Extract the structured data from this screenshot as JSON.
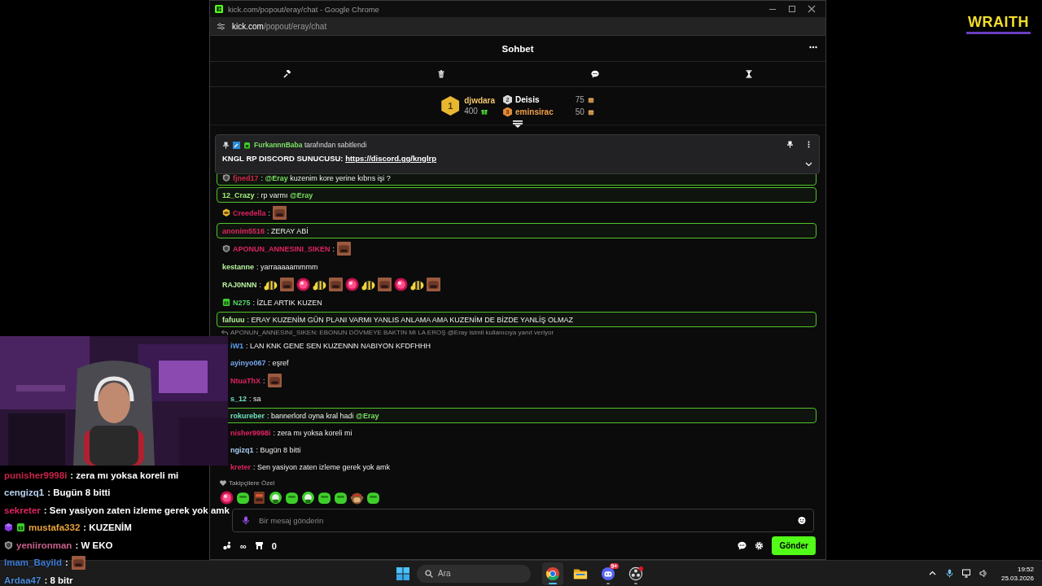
{
  "browser": {
    "title": "kick.com/popout/eray/chat - Google Chrome",
    "url_host": "kick.com",
    "url_path": "/popout/eray/chat"
  },
  "chat": {
    "title": "Sohbet",
    "leaderboard": [
      {
        "rank": "1",
        "user": "djwdara",
        "amount": "400",
        "reward": {
          "kind": "gift"
        },
        "color": "#f2c46a"
      },
      {
        "rank": "2",
        "user": "Deisis",
        "amount": "75",
        "reward": {
          "kind": "coin"
        },
        "color": "#ffffff"
      },
      {
        "rank": "3",
        "user": "eminsirac",
        "amount": "50",
        "reward": {
          "kind": "coin"
        },
        "color": "#f0a04a"
      }
    ],
    "pinned": {
      "pinned_by": "FurkannnBaba",
      "suffix": "tarafından sabitlendi",
      "text": "KNGL RP DISCORD SUNUCUSU:",
      "link": "https://discord.gg/knglrp"
    },
    "messages": [
      {
        "badge": {
          "kind": "shield"
        },
        "user": "fjned17",
        "color": "#d4264d",
        "highlighted": true,
        "text": [
          {
            "kind": "text",
            "text": ": "
          },
          {
            "kind": "mention",
            "text": "@Eray"
          },
          {
            "kind": "text",
            "text": " kuzenim kore yerine kıbrıs işi ?"
          }
        ]
      },
      {
        "user": "12_Crazy",
        "color": "#a3f07a",
        "highlighted": true,
        "text": [
          {
            "kind": "text",
            "text": ": rp varmı "
          },
          {
            "kind": "mention",
            "text": "@Eray"
          }
        ]
      },
      {
        "badge": {
          "kind": "crown"
        },
        "user": "Creedella",
        "color": "#e0245e",
        "highlighted": false,
        "text": [
          {
            "kind": "text",
            "text": ":"
          }
        ],
        "emotes": [
          {
            "kind": "face"
          }
        ]
      },
      {
        "user": "anonim5516",
        "color": "#e0245e",
        "highlighted": true,
        "text": [
          {
            "kind": "text",
            "text": ": ZERAY ABİ"
          }
        ]
      },
      {
        "badge": {
          "kind": "shield"
        },
        "user": "APONUN_ANNESINI_SIKEN",
        "color": "#e0245e",
        "highlighted": false,
        "text": [
          {
            "kind": "text",
            "text": ":"
          }
        ],
        "emotes": [
          {
            "kind": "face"
          }
        ]
      },
      {
        "user": "kestanne",
        "color": "#b6f09c",
        "highlighted": false,
        "text": [
          {
            "kind": "text",
            "text": ": yarraaaaammmm"
          }
        ]
      },
      {
        "user": "RAJ0NNN",
        "color": "#b6f09c",
        "highlighted": false,
        "text": [
          {
            "kind": "text",
            "text": ":"
          }
        ],
        "emotes": [
          {
            "kind": "bee"
          },
          {
            "kind": "face"
          },
          {
            "kind": "orb"
          },
          {
            "kind": "bee"
          },
          {
            "kind": "face"
          },
          {
            "kind": "orb"
          },
          {
            "kind": "bee"
          },
          {
            "kind": "face"
          },
          {
            "kind": "orb"
          },
          {
            "kind": "bee"
          },
          {
            "kind": "face"
          }
        ]
      },
      {
        "badge": {
          "kind": "gift"
        },
        "user": "N275",
        "color": "#56d86a",
        "highlighted": false,
        "text": [
          {
            "kind": "text",
            "text": ": İZLE ARTIK KUZEN"
          }
        ]
      },
      {
        "user": "fafuuu",
        "color": "#b6f09c",
        "highlighted": true,
        "text": [
          {
            "kind": "text",
            "text": ": ERAY KUZENİM GÜN PLANI VARMI YANLIS ANLAMA AMA KUZENİM DE BİZDE YANLİŞ OLMAZ"
          }
        ]
      },
      {
        "reply": "APONUN_ANNESINI_SIKEN: EBONUN DÖVMEYE BAKTIN MI LA EROŞ @Eray isimli kullanıcıya yanıt veriyor",
        "partly_hidden": true,
        "user": "iW1",
        "color": "#5aa0f0",
        "highlighted": false,
        "text": [
          {
            "kind": "text",
            "text": ": LAN KNK GENE SEN KUZENNN NABIYON KFDFHHH"
          }
        ]
      },
      {
        "partly_hidden": true,
        "user": "ayinyo067",
        "color": "#78a8f0",
        "highlighted": false,
        "text": [
          {
            "kind": "text",
            "text": ": eşref"
          }
        ]
      },
      {
        "partly_hidden": true,
        "user": "NtuaThX",
        "color": "#e0245e",
        "highlighted": false,
        "text": [
          {
            "kind": "text",
            "text": ":"
          }
        ],
        "emotes": [
          {
            "kind": "face"
          }
        ]
      },
      {
        "partly_hidden": true,
        "user": "s_12",
        "color": "#6fe0c0",
        "highlighted": false,
        "text": [
          {
            "kind": "text",
            "text": ": sa"
          }
        ]
      },
      {
        "partly_hidden": true,
        "user": "rokureber",
        "color": "#6fe0c0",
        "highlighted": true,
        "text": [
          {
            "kind": "text",
            "text": ": bannerlord oyna kral hadi "
          },
          {
            "kind": "mention",
            "text": "@Eray"
          }
        ]
      },
      {
        "partly_hidden": true,
        "user": "nisher9998i",
        "color": "#e0245e",
        "highlighted": false,
        "text": [
          {
            "kind": "text",
            "text": ": zera mı yoksa koreli mi"
          }
        ]
      },
      {
        "partly_hidden": true,
        "user": "ngizq1",
        "color": "#a8c8f0",
        "highlighted": false,
        "text": [
          {
            "kind": "text",
            "text": ": Bugün 8 bitti"
          }
        ]
      },
      {
        "partly_hidden": true,
        "user": "kreter",
        "color": "#e0245e",
        "highlighted": false,
        "text": [
          {
            "kind": "text",
            "text": ": Sen yasiyon zaten izleme gerek yok amk"
          }
        ]
      }
    ],
    "followers_label": "Takipçilere Özel",
    "follower_emotes": [
      {
        "kind": "orb"
      },
      {
        "kind": "blob"
      },
      {
        "kind": "box"
      },
      {
        "kind": "guy"
      },
      {
        "kind": "blob"
      },
      {
        "kind": "guy"
      },
      {
        "kind": "blob"
      },
      {
        "kind": "blob"
      },
      {
        "kind": "monkey"
      },
      {
        "kind": "blob"
      }
    ],
    "input_placeholder": "Bir mesaj gönderin",
    "points": "∞",
    "store_count": "0",
    "send": "Gönder"
  },
  "stream_chat": [
    {
      "user": "punisher9998i",
      "color": "#c8234a",
      "text": ": zera mı yoksa koreli mi"
    },
    {
      "user": "cengizq1",
      "color": "#b9d3f0",
      "text": ": Bugün 8 bitti"
    },
    {
      "user": "sekreter",
      "color": "#e0245e",
      "text": ": Sen yasiyon zaten izleme gerek yok amk"
    },
    {
      "badges": [
        {
          "kind": "cube"
        },
        {
          "kind": "gift"
        }
      ],
      "user": "mustafa332",
      "color": "#e8a33a",
      "text": ": KUZENİM"
    },
    {
      "badges": [
        {
          "kind": "shield"
        }
      ],
      "user": "yeniironman",
      "color": "#c8608a",
      "text": ": W EKO"
    },
    {
      "user": "Imam_Bayild",
      "color": "#3d7dd8",
      "text": ":",
      "emote": {
        "kind": "face"
      }
    },
    {
      "user": "Ardaa47",
      "color": "#4a8ad8",
      "text": ": 8 bitr"
    }
  ],
  "logo": "WRAITH",
  "taskbar": {
    "search_placeholder": "Ara",
    "apps": [
      {
        "kind": "chrome",
        "selected": true,
        "running": true
      },
      {
        "kind": "folder",
        "selected": false,
        "running": false
      },
      {
        "kind": "discord",
        "selected": false,
        "running": true,
        "badge": "9+"
      },
      {
        "kind": "obs",
        "selected": false,
        "running": true
      }
    ],
    "time": "19:52",
    "date": "25.03.2026"
  }
}
